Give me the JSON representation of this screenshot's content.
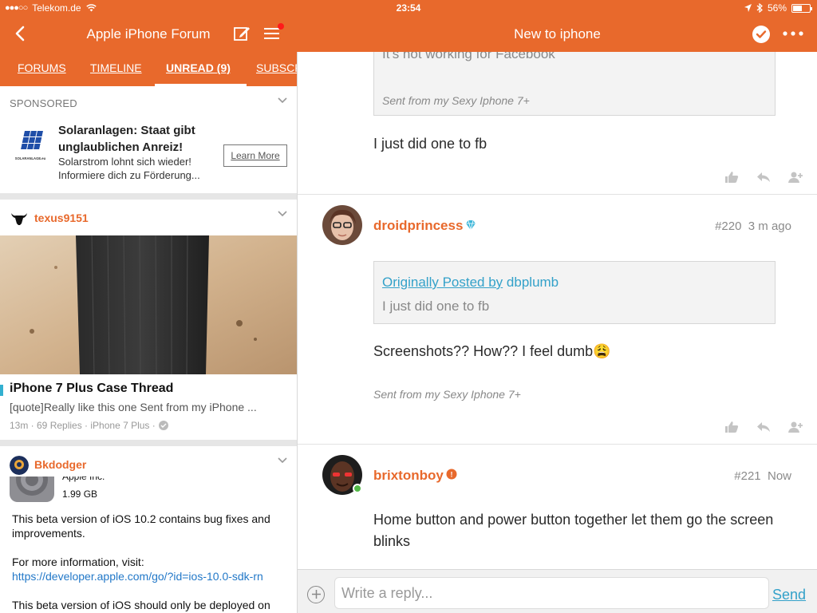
{
  "status_bar": {
    "carrier": "Telekom.de",
    "signal_dots": "●●●○○",
    "time": "23:54",
    "battery": "56%",
    "battery_level": 0.56
  },
  "left_header": {
    "title": "Apple iPhone Forum"
  },
  "right_header": {
    "title": "New to iphone"
  },
  "tabs": [
    {
      "label": "FORUMS"
    },
    {
      "label": "TIMELINE"
    },
    {
      "label": "UNREAD (9)"
    },
    {
      "label": "SUBSCR"
    }
  ],
  "ad": {
    "label": "SPONSORED",
    "title": "Solaranlagen: Staat gibt unglaublichen Anreiz!",
    "description": "Solarstrom lohnt sich wieder! Informiere dich zu Förderung...",
    "cta": "Learn More",
    "logo_text": "SOLARANLAGE.eu"
  },
  "feed": [
    {
      "user": "texus9151",
      "title": "iPhone 7 Plus Case Thread",
      "snippet": "[quote]Really like this one   Sent from my iPhone ...",
      "meta": "13m · 69 Replies · iPhone 7 Plus ·"
    },
    {
      "user": "Bkdodger",
      "app_clip_text": "Apple Inc.",
      "app_size": "1.99 GB",
      "body_1": "This beta version of iOS 10.2 contains bug fixes and improvements.",
      "body_2": "For more information, visit:",
      "link": "https://developer.apple.com/go/?id=ios-10.0-sdk-rn",
      "body_3": "This beta version of iOS should only be deployed on"
    }
  ],
  "thread": {
    "top_quote_text": "It's not working for Facebook",
    "top_quote_signature": "Sent from my Sexy Iphone 7+",
    "top_body": "I just did one to fb",
    "posts": [
      {
        "user": "droidprincess",
        "number": "#220",
        "time": "3 m ago",
        "quote_prefix": "Originally Posted by",
        "quote_user": "dbplumb",
        "quote_text": "I just did one to fb",
        "body": "Screenshots?? How?? I feel dumb😩",
        "signature": "Sent from my Sexy Iphone 7+"
      },
      {
        "user": "brixtonboy",
        "number": "#221",
        "time": "Now",
        "body": "Home button and power button together let them go the screen blinks"
      }
    ]
  },
  "reply": {
    "placeholder": "Write a reply...",
    "send": "Send"
  },
  "colors": {
    "accent": "#e8692c",
    "link": "#33a1c9",
    "online": "#54b948"
  }
}
